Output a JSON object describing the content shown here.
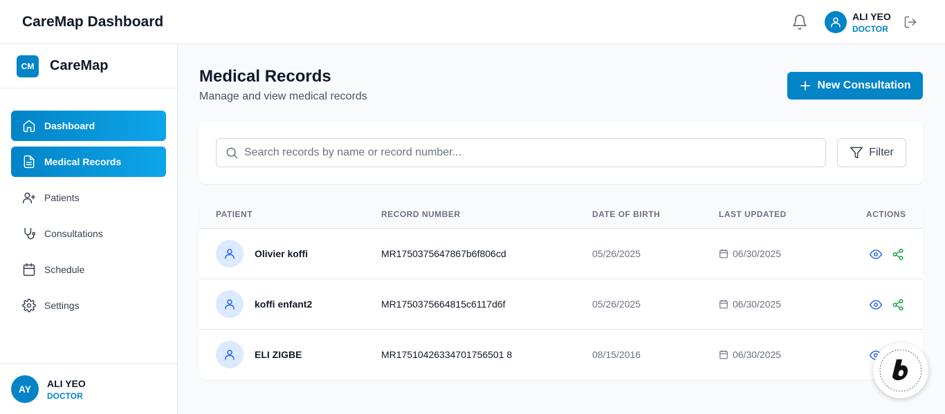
{
  "header": {
    "title": "CareMap Dashboard",
    "user": {
      "name": "ALI YEO",
      "role": "DOCTOR"
    }
  },
  "sidebar": {
    "logo_text": "CM",
    "brand": "CareMap",
    "items": [
      {
        "label": "Dashboard",
        "icon": "home-icon",
        "active": true
      },
      {
        "label": "Medical Records",
        "icon": "file-text-icon",
        "active": true
      },
      {
        "label": "Patients",
        "icon": "user-plus-icon",
        "active": false
      },
      {
        "label": "Consultations",
        "icon": "stethoscope-icon",
        "active": false
      },
      {
        "label": "Schedule",
        "icon": "calendar-icon",
        "active": false
      },
      {
        "label": "Settings",
        "icon": "gear-icon",
        "active": false
      }
    ],
    "footer_user": {
      "initials": "AY",
      "name": "ALI YEO",
      "role": "DOCTOR"
    }
  },
  "main": {
    "title": "Medical Records",
    "subtitle": "Manage and view medical records",
    "new_button_label": "New Consultation",
    "search_placeholder": "Search records by name or record number...",
    "filter_label": "Filter",
    "table": {
      "columns": [
        "PATIENT",
        "RECORD NUMBER",
        "DATE OF BIRTH",
        "LAST UPDATED",
        "ACTIONS"
      ],
      "rows": [
        {
          "name": "Olivier koffi",
          "record": "MR1750375647867b6f806cd",
          "dob": "05/26/2025",
          "updated": "06/30/2025"
        },
        {
          "name": "koffi enfant2",
          "record": "MR1750375664815c6117d6f",
          "dob": "05/26/2025",
          "updated": "06/30/2025"
        },
        {
          "name": "ELI ZIGBE",
          "record": "MR17510426334701756501 8",
          "dob": "08/15/2016",
          "updated": "06/30/2025"
        }
      ]
    }
  },
  "colors": {
    "accent": "#0284c7",
    "view_icon": "#2563eb",
    "share_icon": "#16a34a"
  }
}
